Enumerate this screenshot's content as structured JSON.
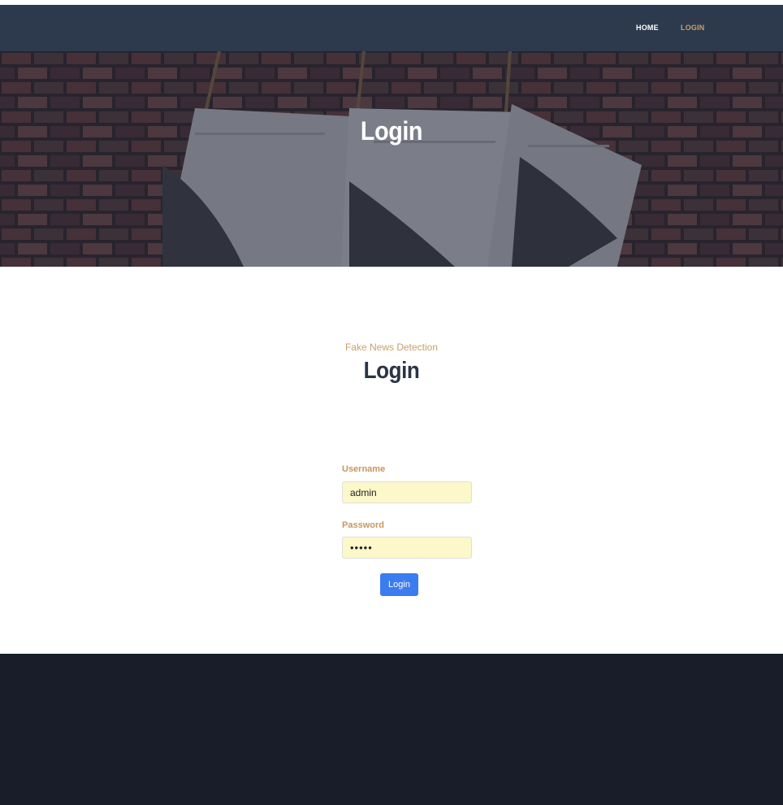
{
  "navbar": {
    "links": [
      {
        "label": "HOME"
      },
      {
        "label": "LOGIN"
      }
    ]
  },
  "hero": {
    "title": "Login"
  },
  "section": {
    "subtitle": "Fake News Detection",
    "title": "Login"
  },
  "form": {
    "username_label": "Username",
    "username_value": "admin",
    "password_label": "Password",
    "password_value": "admin",
    "submit_label": "Login"
  },
  "colors": {
    "navbar_bg": "#2d3a4d",
    "accent_gold": "#c8a06a",
    "heading_dark": "#2b3445",
    "input_bg": "#fdf8c9",
    "button_blue": "#3b7cf0",
    "footer_bg": "#181d29"
  }
}
